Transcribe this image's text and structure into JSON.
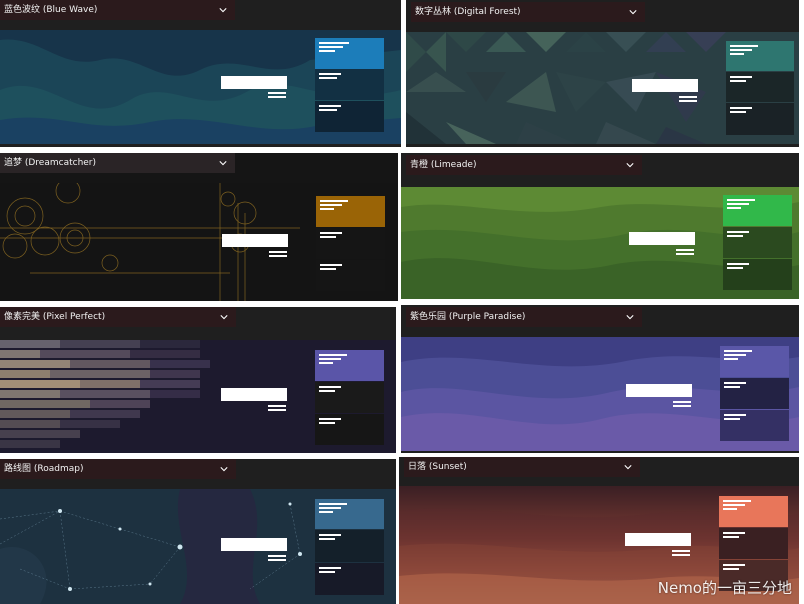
{
  "themes": [
    {
      "name": "蓝色波纹 (Blue Wave)",
      "accent": "#1c7dba",
      "bg": "#16384a"
    },
    {
      "name": "数字丛林 (Digital Forest)",
      "accent": "#2e7670",
      "bg": "#253a3d"
    },
    {
      "name": "追梦 (Dreamcatcher)",
      "accent": "#9a6406",
      "bg": "#141414"
    },
    {
      "name": "青橙 (Limeade)",
      "accent": "#31b84a",
      "bg": "#4d7a2a"
    },
    {
      "name": "像素完美 (Pixel Perfect)",
      "accent": "#5a55a8",
      "bg": "#1e1a30"
    },
    {
      "name": "紫色乐园 (Purple Paradise)",
      "accent": "#5a57a8",
      "bg": "#3c3d7a"
    },
    {
      "name": "路线图 (Roadmap)",
      "accent": "#37698e",
      "bg": "#1e3140"
    },
    {
      "name": "日落 (Sunset)",
      "accent": "#e8765a",
      "bg": "#4a2828"
    }
  ],
  "watermark": "Nemo的一亩三分地"
}
